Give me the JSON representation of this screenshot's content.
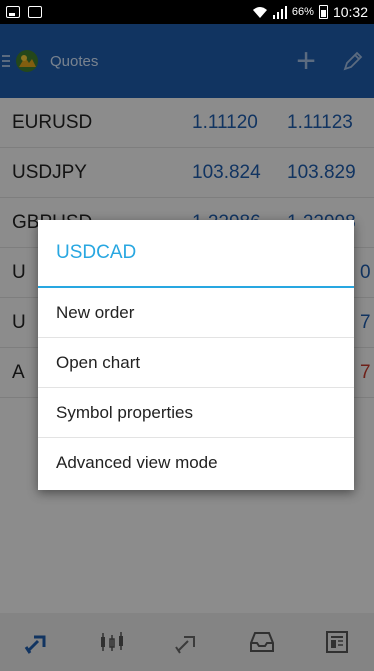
{
  "status_bar": {
    "battery_percent": "66%",
    "time": "10:32"
  },
  "toolbar": {
    "title": "Quotes"
  },
  "quotes": [
    {
      "symbol": "EURUSD",
      "bid": "1.11120",
      "ask": "1.11123"
    },
    {
      "symbol": "USDJPY",
      "bid": "103.824",
      "ask": "103.829"
    },
    {
      "symbol": "GBPUSD",
      "bid": "1.22986",
      "ask": "1.22998"
    },
    {
      "symbol": "U",
      "bid": "",
      "ask": "0"
    },
    {
      "symbol": "U",
      "bid": "",
      "ask": "7"
    },
    {
      "symbol": "A",
      "bid": "",
      "ask": "7"
    }
  ],
  "context_menu": {
    "title": "USDCAD",
    "items": [
      "New order",
      "Open chart",
      "Symbol properties",
      "Advanced view mode"
    ]
  },
  "bottom_nav": [
    "quotes-icon",
    "chart-icon",
    "trade-icon",
    "history-icon",
    "news-icon"
  ],
  "colors": {
    "toolbar": "#1e5aa8",
    "price_blue": "#1e5aa8",
    "price_red": "#c0392b",
    "menu_accent": "#28a7e1"
  }
}
